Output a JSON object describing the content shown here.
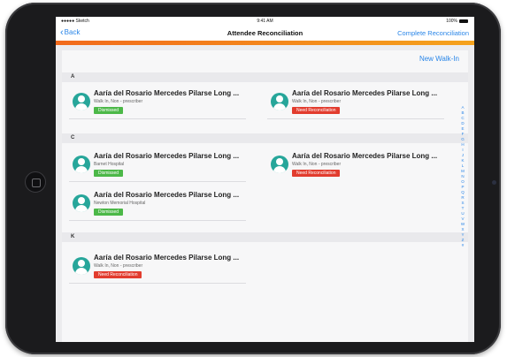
{
  "status": {
    "carrier": "●●●●● Sketch",
    "wifi": "wifi-icon",
    "time": "9:41 AM",
    "battery": "100%"
  },
  "nav": {
    "back_label": "Back",
    "title": "Attendee Reconciliation",
    "complete_label": "Complete Reconciliation"
  },
  "main": {
    "walkin_button": "New Walk-In"
  },
  "sections": [
    {
      "letter": "A",
      "items": [
        {
          "name": "Aaría del Rosario Mercedes Pilarse Long ...",
          "subtitle": "Walk In, Non - prescriber",
          "status": "Dismissed"
        },
        {
          "name": "Aaría del Rosario Mercedes Pilarse Long ...",
          "subtitle": "Walk In, Non - prescriber",
          "status": "Need Reconciliation"
        }
      ]
    },
    {
      "letter": "C",
      "items": [
        {
          "name": "Aaría del Rosario Mercedes Pilarse Long ...",
          "subtitle": "Barnet Hospital",
          "status": "Dismissed"
        },
        {
          "name": "Aaría del Rosario Mercedes Pilarse Long ...",
          "subtitle": "Walk In, Non - prescriber",
          "status": "Need Reconciliation"
        },
        {
          "name": "Aaría del Rosario Mercedes Pilarse Long ...",
          "subtitle": "Newton Memorial Hospital",
          "status": "Dismissed"
        }
      ]
    },
    {
      "letter": "K",
      "items": [
        {
          "name": "Aaría del Rosario Mercedes Pilarse Long ...",
          "subtitle": "Walk In, Non - prescriber",
          "status": "Need Reconciliation"
        }
      ]
    }
  ],
  "index_letters": [
    "A",
    "B",
    "C",
    "D",
    "E",
    "F",
    "G",
    "H",
    "I",
    "J",
    "K",
    "L",
    "M",
    "N",
    "O",
    "P",
    "Q",
    "R",
    "S",
    "T",
    "U",
    "V",
    "W",
    "X",
    "Y",
    "Z",
    "#"
  ],
  "colors": {
    "accent_blue": "#2a86e8",
    "accent_orange": "#f26a1b",
    "badge_green": "#4cb848",
    "badge_red": "#e23c2e",
    "avatar": "#27a69a"
  }
}
